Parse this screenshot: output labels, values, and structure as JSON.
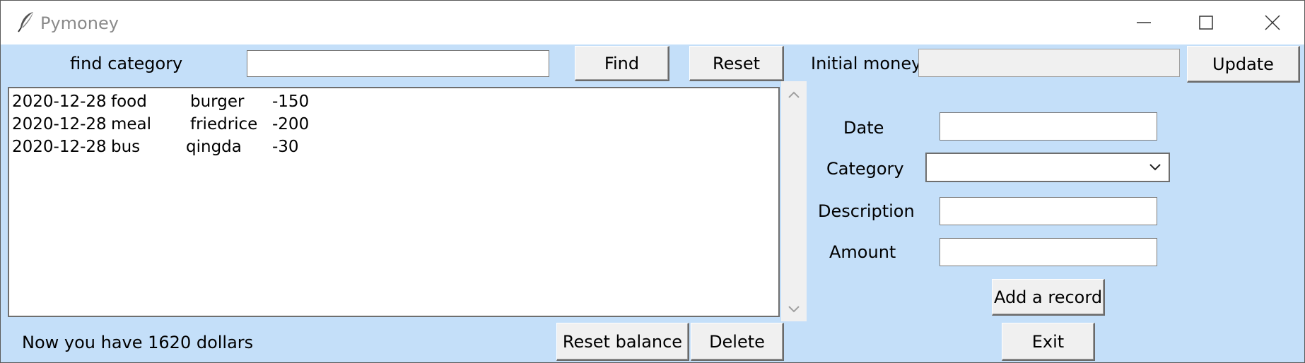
{
  "window": {
    "title": "Pymoney",
    "app_icon": "feather-icon",
    "controls": [
      "minimize-icon",
      "maximize-icon",
      "close-icon"
    ]
  },
  "search": {
    "label": "find category",
    "value": "",
    "find_label": "Find",
    "reset_label": "Reset"
  },
  "records": [
    {
      "date": "2020-12-28",
      "category": "food",
      "description": "burger",
      "amount": "-150"
    },
    {
      "date": "2020-12-28",
      "category": "meal",
      "description": "friedrice",
      "amount": "-200"
    },
    {
      "date": "2020-12-28",
      "category": "bus",
      "description": "qingda",
      "amount": "-30"
    }
  ],
  "balance": {
    "status_text": "Now you have 1620 dollars",
    "reset_balance_label": "Reset balance",
    "delete_label": "Delete"
  },
  "initial_money": {
    "label": "Initial money",
    "value": "",
    "update_label": "Update"
  },
  "form": {
    "date_label": "Date",
    "date_value": "",
    "category_label": "Category",
    "category_value": "",
    "description_label": "Description",
    "description_value": "",
    "amount_label": "Amount",
    "amount_value": "",
    "add_label": "Add a record",
    "exit_label": "Exit"
  },
  "colors": {
    "window_background": "#c4dff9",
    "button_face": "#f0f0f0",
    "title_text": "#8a8a8a"
  }
}
